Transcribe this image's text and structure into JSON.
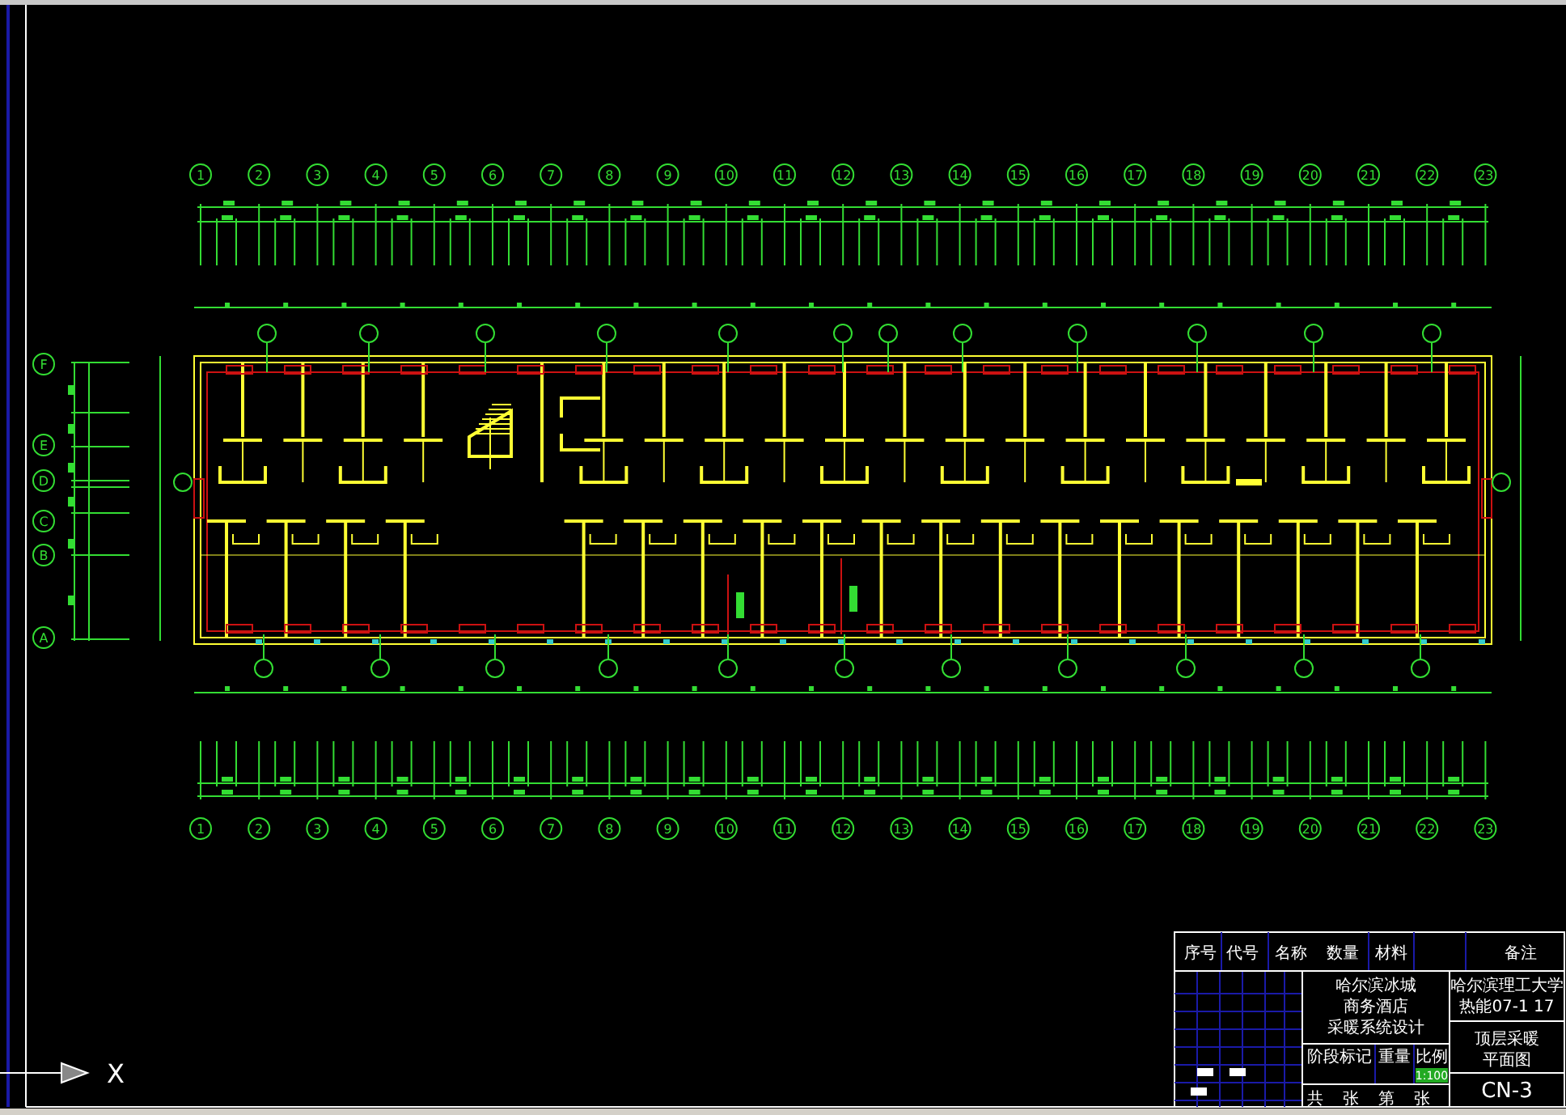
{
  "drawing": {
    "top_axis": [
      "1",
      "2",
      "3",
      "4",
      "5",
      "6",
      "7",
      "8",
      "9",
      "10",
      "11",
      "12",
      "13",
      "14",
      "15",
      "16",
      "17",
      "18",
      "19",
      "20",
      "21",
      "22",
      "23"
    ],
    "bottom_axis": [
      "1",
      "2",
      "3",
      "4",
      "5",
      "6",
      "7",
      "8",
      "9",
      "10",
      "11",
      "12",
      "13",
      "14",
      "15",
      "16",
      "17",
      "18",
      "19",
      "20",
      "21",
      "22",
      "23"
    ],
    "left_axis": [
      "F",
      "E",
      "D",
      "C",
      "B",
      "A"
    ],
    "ucs_label": "X"
  },
  "title_block": {
    "header": [
      "序号",
      "代号",
      "名称",
      "数量",
      "材料",
      "备注"
    ],
    "project": [
      "哈尔滨冰城",
      "商务酒店",
      "采暖系统设计"
    ],
    "school": "哈尔滨理工大学",
    "class_no": "热能07-1 17",
    "drawing_name": [
      "顶层采暖",
      "平面图"
    ],
    "drawing_no": "CN-3",
    "stage_mark": "阶段标记",
    "weight": "重量",
    "scale": "比例",
    "scale_value": "1:100",
    "sheets": [
      "共",
      "张",
      "第",
      "张"
    ]
  }
}
